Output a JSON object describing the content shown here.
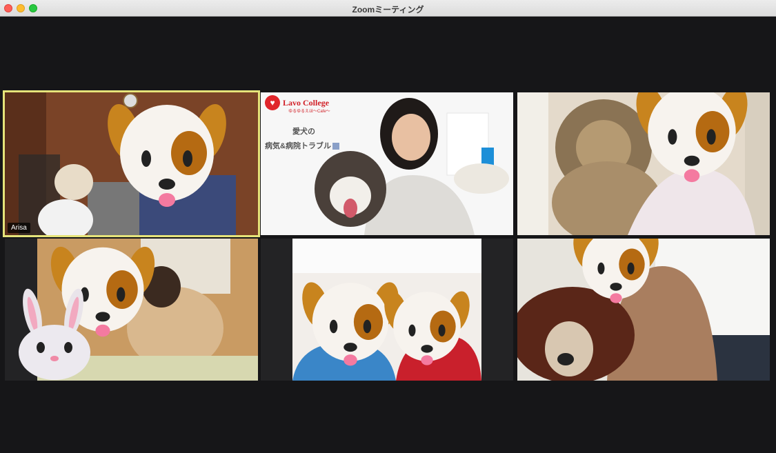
{
  "window": {
    "title": "Zoomミーティング"
  },
  "participants": [
    {
      "name": "Arisa",
      "speaking": true,
      "filter": "dog-face"
    },
    {
      "name": "",
      "speaking": false,
      "filter": "none"
    },
    {
      "name": "",
      "speaking": false,
      "filter": "dog-face"
    },
    {
      "name": "",
      "speaking": false,
      "filter": "dog-face+rabbit-face"
    },
    {
      "name": "",
      "speaking": false,
      "filter": "dog-face x2"
    },
    {
      "name": "",
      "speaking": false,
      "filter": "dog-face"
    }
  ],
  "banner": {
    "logo_text": "Lavo College",
    "logo_sub": "ゆるゆるえほ〜Cafe〜",
    "line1": "愛犬の",
    "line2": "病気&病院トラブル"
  },
  "colors": {
    "active_speaker": "#e6e47a",
    "background": "#161618"
  }
}
